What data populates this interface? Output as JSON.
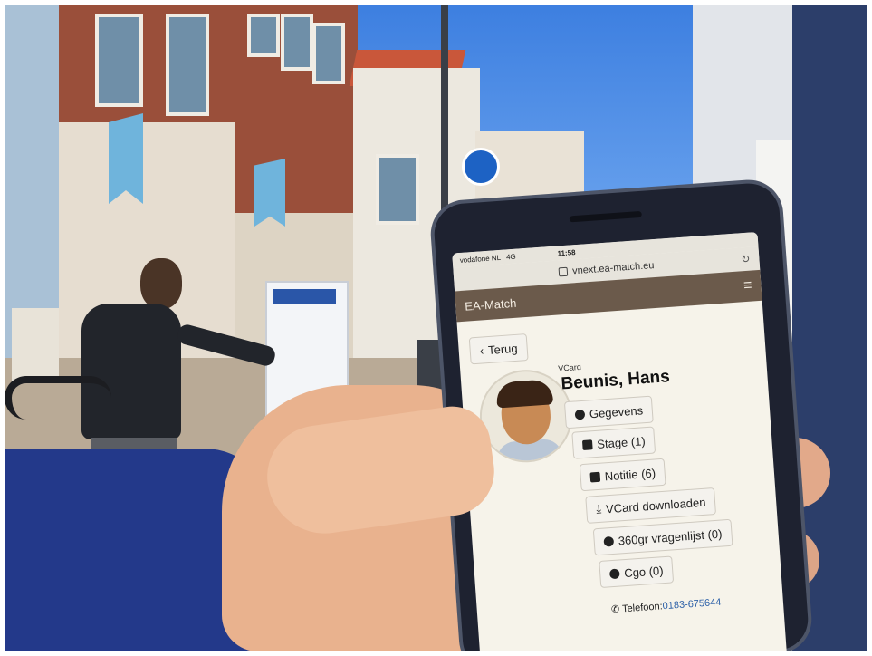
{
  "phone": {
    "status": {
      "carrier": "vodafone NL",
      "network": "4G",
      "time": "11:58"
    },
    "url": "vnext.ea-match.eu",
    "nav": {
      "brand": "EA-Match"
    },
    "back_label": "Terug",
    "vcard_label": "VCard",
    "name": "Beunis, Hans",
    "buttons": {
      "gegevens": "Gegevens",
      "stage": "Stage (1)",
      "notitie": "Notitie (6)",
      "vcard_download": "VCard downloaden",
      "vragenlijst": "360gr vragenlijst (0)",
      "cgo": "Cgo (0)"
    },
    "phone_prefix": "Telefoon:",
    "phone_number": "0183-675644"
  },
  "icons": {
    "lock": "lock-icon",
    "reload": "reload-icon",
    "menu": "hamburger-menu-icon",
    "back": "chevron-left-icon"
  },
  "colors": {
    "navbar": "#6b5a4b",
    "screen_bg": "#f6f3ea",
    "sleeve": "#23398a",
    "sky": "#3d7fe0"
  }
}
